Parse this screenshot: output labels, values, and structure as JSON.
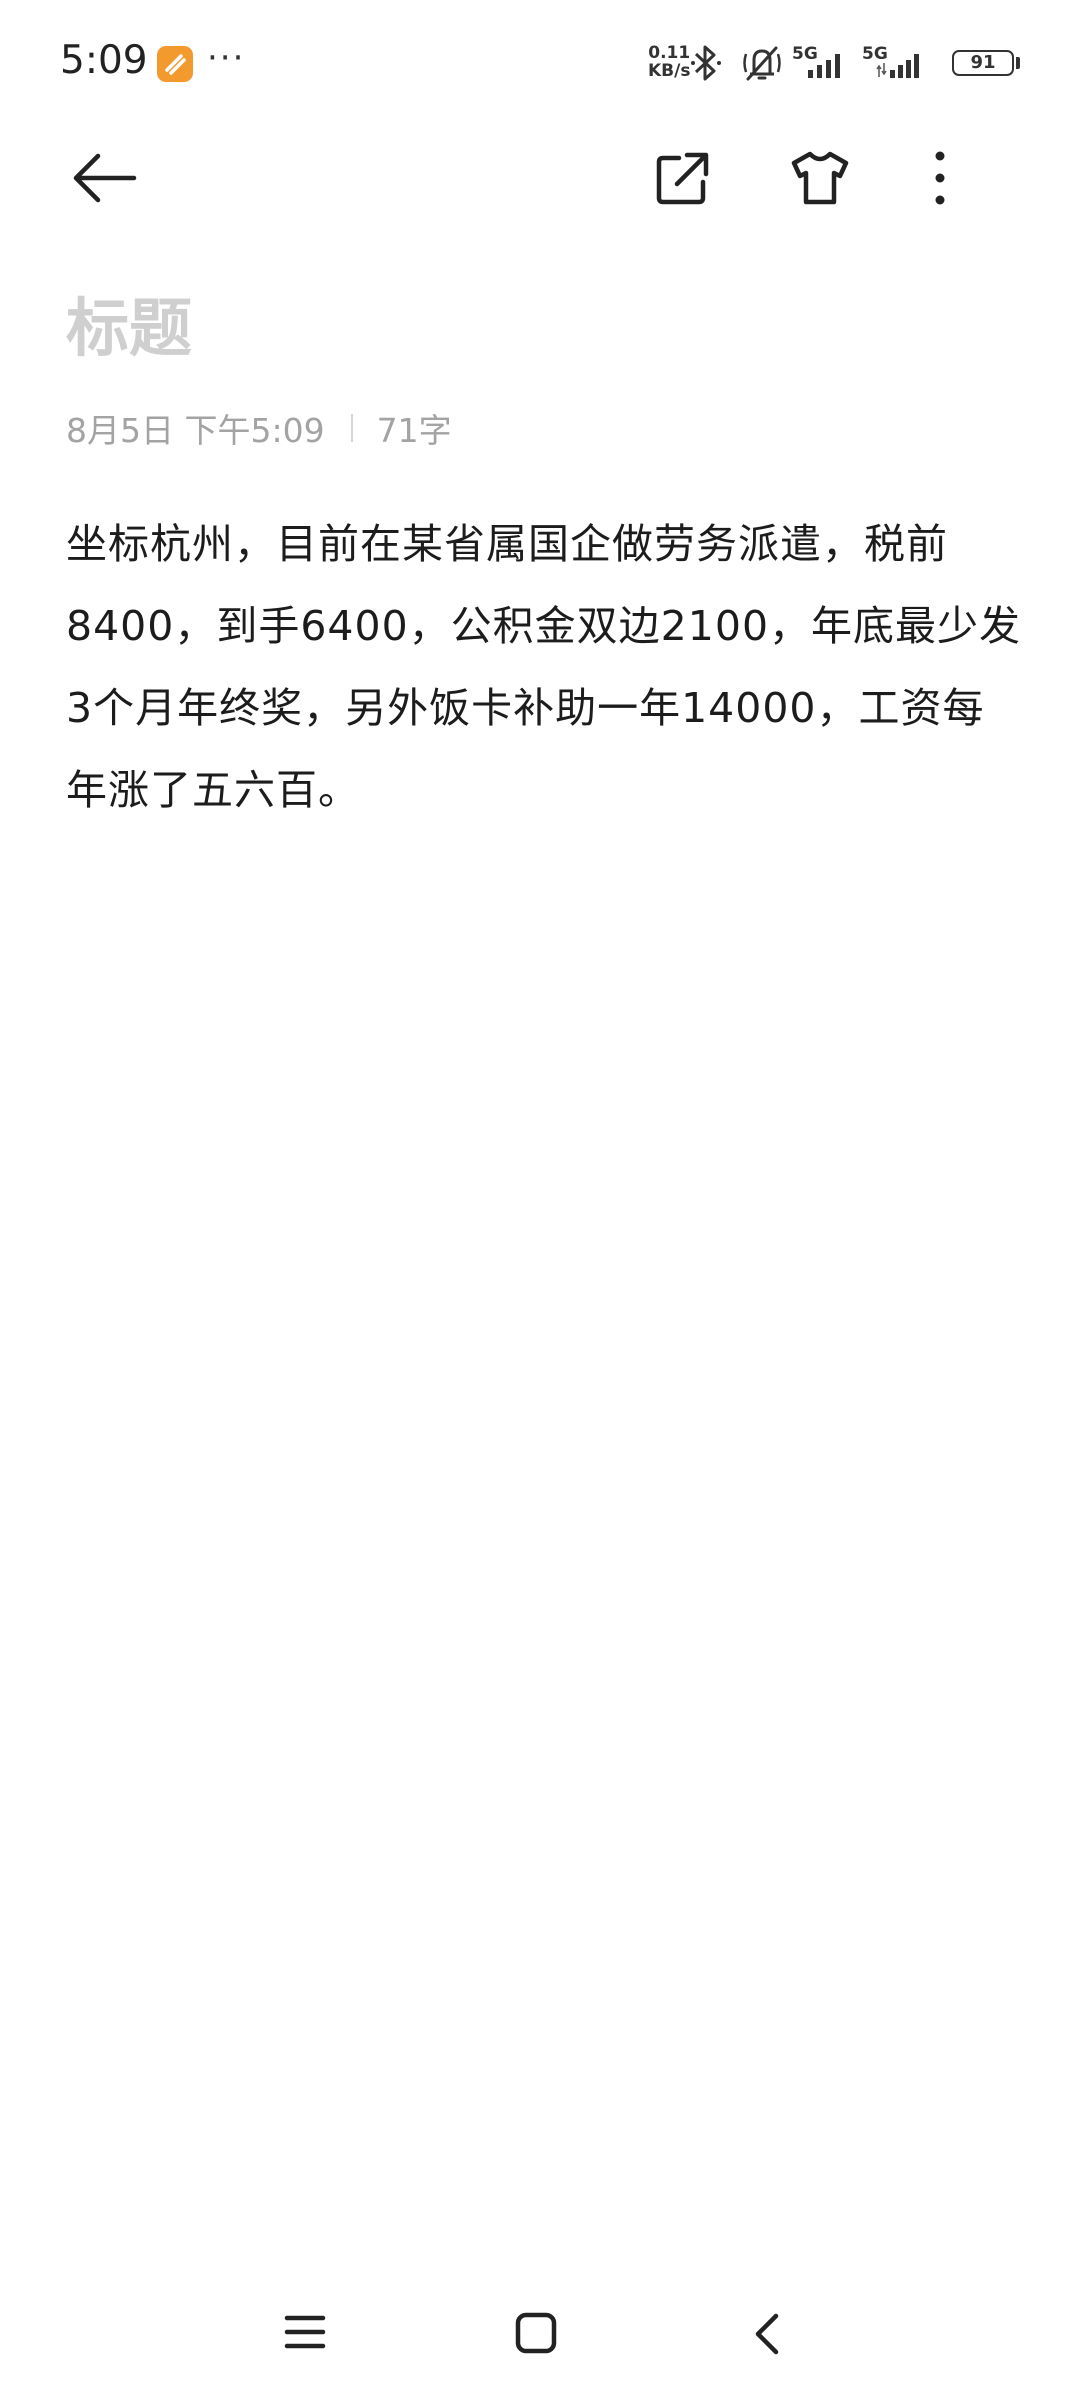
{
  "status_bar": {
    "time": "5:09",
    "more": "···",
    "net_speed_value": "0.11",
    "net_speed_unit": "KB/s",
    "sim1_label": "5G",
    "sim2_label": "5G",
    "battery": "91",
    "icons": [
      "app-badge-icon",
      "bluetooth-icon",
      "mute-icon",
      "signal-icon",
      "signal-icon",
      "battery-icon"
    ]
  },
  "toolbar": {
    "icons": [
      "back-arrow-icon",
      "share-icon",
      "shirt-icon",
      "more-vertical-icon"
    ]
  },
  "note": {
    "title_placeholder": "标题",
    "date": "8月5日 下午5:09",
    "char_count": "71字",
    "body": "坐标杭州，目前在某省属国企做劳务派遣，税前8400，到手6400，公积金双边2100，年底最少发3个月年终奖，另外饭卡补助一年14000，工资每年涨了五六百。"
  },
  "nav_bar": {
    "icons": [
      "menu-icon",
      "home-icon",
      "back-icon"
    ]
  },
  "colors": {
    "background": "#ffffff",
    "title_placeholder": "#cfcfcf",
    "meta_text": "#a3a3a3",
    "body_text": "#1c1c1c",
    "app_badge": "#f29a2e"
  }
}
